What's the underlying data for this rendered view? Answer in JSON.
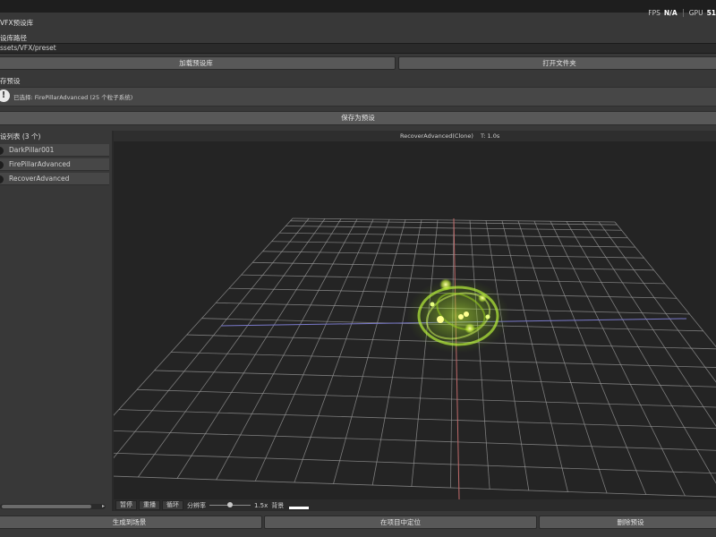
{
  "stats": {
    "fps_label": "FPS",
    "fps_value": "N/A",
    "gpu_label": "GPU",
    "gpu_value": "51"
  },
  "window": {
    "title": "VFX预设库"
  },
  "path": {
    "label": "设库路径",
    "value": "ssets/VFX/preset"
  },
  "toolbar": {
    "load_label": "加载预设库",
    "open_folder_label": "打开文件夹"
  },
  "save_section": {
    "label": "存预设",
    "info_text": "已选择: FirePillarAdvanced (25 个粒子系统)",
    "save_button": "保存为预设"
  },
  "preset_list": {
    "label": "设列表 (3 个)",
    "items": [
      {
        "label": "DarkPillar001"
      },
      {
        "label": "FirePillarAdvanced"
      },
      {
        "label": "RecoverAdvanced"
      }
    ]
  },
  "viewport": {
    "object_name": "RecoverAdvanced(Clone)",
    "time_label": "T: 1.0s",
    "controls": {
      "pause": "暂停",
      "replay": "重播",
      "loop": "循环",
      "resolution_label": "分辨率",
      "resolution_value": "1.5x",
      "resolution_level": 0.5,
      "background_label": "背景",
      "background_color": "#ffffff"
    },
    "colors": {
      "background": "#242424",
      "grid": "#9a9a9a",
      "x_axis": "#7a7acc",
      "z_axis": "#c06a6a",
      "effect": "#a8e52a"
    }
  },
  "footer": {
    "generate_label": "生成到场景",
    "locate_label": "在项目中定位",
    "delete_label": "删除预设"
  }
}
